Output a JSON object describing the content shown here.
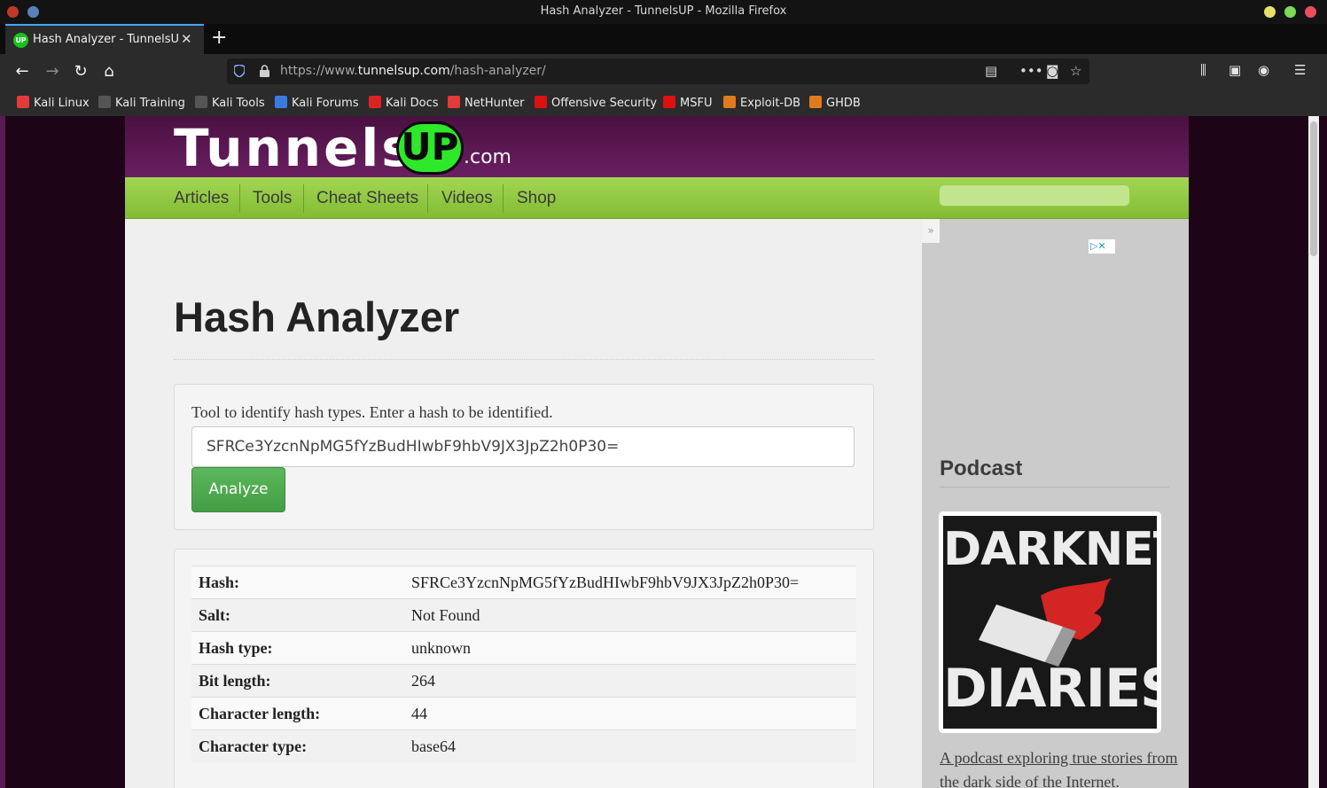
{
  "window": {
    "title": "Hash Analyzer - TunnelsUP - Mozilla Firefox"
  },
  "tab": {
    "title": "Hash Analyzer - TunnelsUP",
    "favicon": "UP"
  },
  "urlbar": {
    "url_prefix": "https://www.",
    "url_domain": "tunnelsup.com",
    "url_path": "/hash-analyzer/"
  },
  "bookmarks": [
    {
      "label": "Kali Linux",
      "icon": "kali-dragon-icon"
    },
    {
      "label": "Kali Training",
      "icon": "kali-training-icon"
    },
    {
      "label": "Kali Tools",
      "icon": "kali-tools-icon"
    },
    {
      "label": "Kali Forums",
      "icon": "kali-forums-icon"
    },
    {
      "label": "Kali Docs",
      "icon": "kali-docs-icon"
    },
    {
      "label": "NetHunter",
      "icon": "nethunter-icon"
    },
    {
      "label": "Offensive Security",
      "icon": "offsec-icon"
    },
    {
      "label": "MSFU",
      "icon": "msfu-icon"
    },
    {
      "label": "Exploit-DB",
      "icon": "exploitdb-icon"
    },
    {
      "label": "GHDB",
      "icon": "ghdb-icon"
    }
  ],
  "site": {
    "logo_text": "Tunnels",
    "logo_badge": "UP",
    "logo_suffix": ".com",
    "nav": [
      "Articles",
      "Tools",
      "Cheat Sheets",
      "Videos",
      "Shop"
    ],
    "search_placeholder": ""
  },
  "main": {
    "title": "Hash Analyzer",
    "description": "Tool to identify hash types. Enter a hash to be identified.",
    "hash_input_value": "SFRCe3YzcnNpMG5fYzBudHIwbF9hbV9JX3JpZ2h0P30=",
    "analyze_label": "Analyze",
    "results": [
      {
        "label": "Hash:",
        "value": "SFRCe3YzcnNpMG5fYzBudHIwbF9hbV9JX3JpZ2h0P30="
      },
      {
        "label": "Salt:",
        "value": "Not Found"
      },
      {
        "label": "Hash type:",
        "value": "unknown"
      },
      {
        "label": "Bit length:",
        "value": "264"
      },
      {
        "label": "Character length:",
        "value": "44"
      },
      {
        "label": "Character type:",
        "value": "base64"
      }
    ]
  },
  "sidebar": {
    "collapse_label": "»",
    "podcast_heading": "Podcast",
    "podcast_art_top": "DARKNET",
    "podcast_art_bottom": "DIARIES",
    "podcast_link": "A podcast exploring true stories from the dark side of the Internet."
  },
  "colors": {
    "header_purple": "#6a1f62",
    "nav_green": "#8cc63f",
    "logo_green": "#2ee82a",
    "button_green": "#5cb85c",
    "browser_dark": "#2b2b2b"
  }
}
